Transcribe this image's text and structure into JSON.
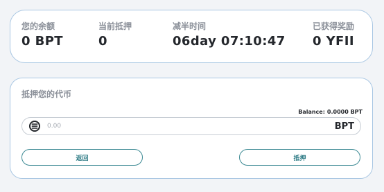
{
  "stats": [
    {
      "label": "您的余额",
      "value": "0 BPT"
    },
    {
      "label": "当前抵押",
      "value": "0"
    },
    {
      "label": "减半时间",
      "value": "06day 07:10:47"
    },
    {
      "label": "已获得奖励",
      "value": "0 YFII"
    }
  ],
  "stake": {
    "title": "抵押您的代币",
    "balance_label": "Balance:",
    "balance_value": "0.0000 BPT",
    "amount_placeholder": "0.00",
    "token": "BPT",
    "token_icon": "bpt-coin-icon",
    "back_label": "返回",
    "stake_label": "抵押"
  },
  "colors": {
    "accent": "#3d8a94",
    "border": "#a9c7e3",
    "label": "#8b9099",
    "text": "#24272c"
  }
}
